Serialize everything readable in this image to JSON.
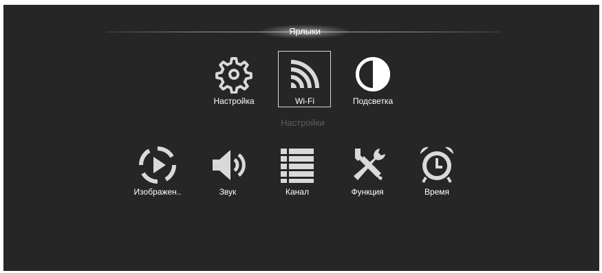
{
  "header": {
    "title": "Ярлыки"
  },
  "shortcuts": [
    {
      "label": "Настройка",
      "icon": "gear-icon"
    },
    {
      "label": "Wi-Fi",
      "icon": "wifi-icon",
      "selected": true
    },
    {
      "label": "Подсветка",
      "icon": "backlight-icon"
    }
  ],
  "section": {
    "title": "Настройки"
  },
  "settings": [
    {
      "label": "Изображен..",
      "icon": "picture-icon"
    },
    {
      "label": "Звук",
      "icon": "speaker-icon"
    },
    {
      "label": "Канал",
      "icon": "channel-list-icon"
    },
    {
      "label": "Функция",
      "icon": "tools-icon"
    },
    {
      "label": "Время",
      "icon": "alarm-clock-icon"
    }
  ],
  "colors": {
    "background": "#262626",
    "icon": "#d9d9d9",
    "text": "#ffffff",
    "section_label": "#5c5c5c"
  }
}
